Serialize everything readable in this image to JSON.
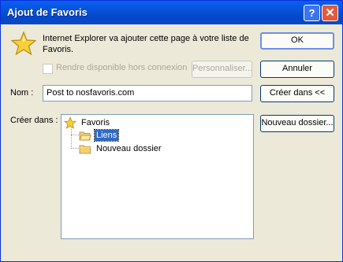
{
  "window": {
    "title": "Ajout de Favoris"
  },
  "titlebar": {
    "help_glyph": "?",
    "close_glyph": "✕"
  },
  "description": "Internet Explorer va ajouter cette page à votre liste de Favoris.",
  "offline": {
    "label": "Rendre disponible hors connexion",
    "checked": false
  },
  "buttons": {
    "ok": "OK",
    "cancel": "Annuler",
    "customize": "Personnaliser...",
    "create_in": "Créer dans <<",
    "new_folder": "Nouveau dossier..."
  },
  "name_field": {
    "label": "Nom :",
    "value": "Post to nosfavoris.com"
  },
  "create_in_label": "Créer dans :",
  "tree": {
    "root": "Favoris",
    "children": [
      {
        "label": "Liens",
        "selected": true
      },
      {
        "label": "Nouveau dossier",
        "selected": false
      }
    ]
  },
  "colors": {
    "title_bar": "#0753d9",
    "dialog_bg": "#ece9d8",
    "selection": "#316ac5",
    "close_button": "#e45a3a"
  }
}
